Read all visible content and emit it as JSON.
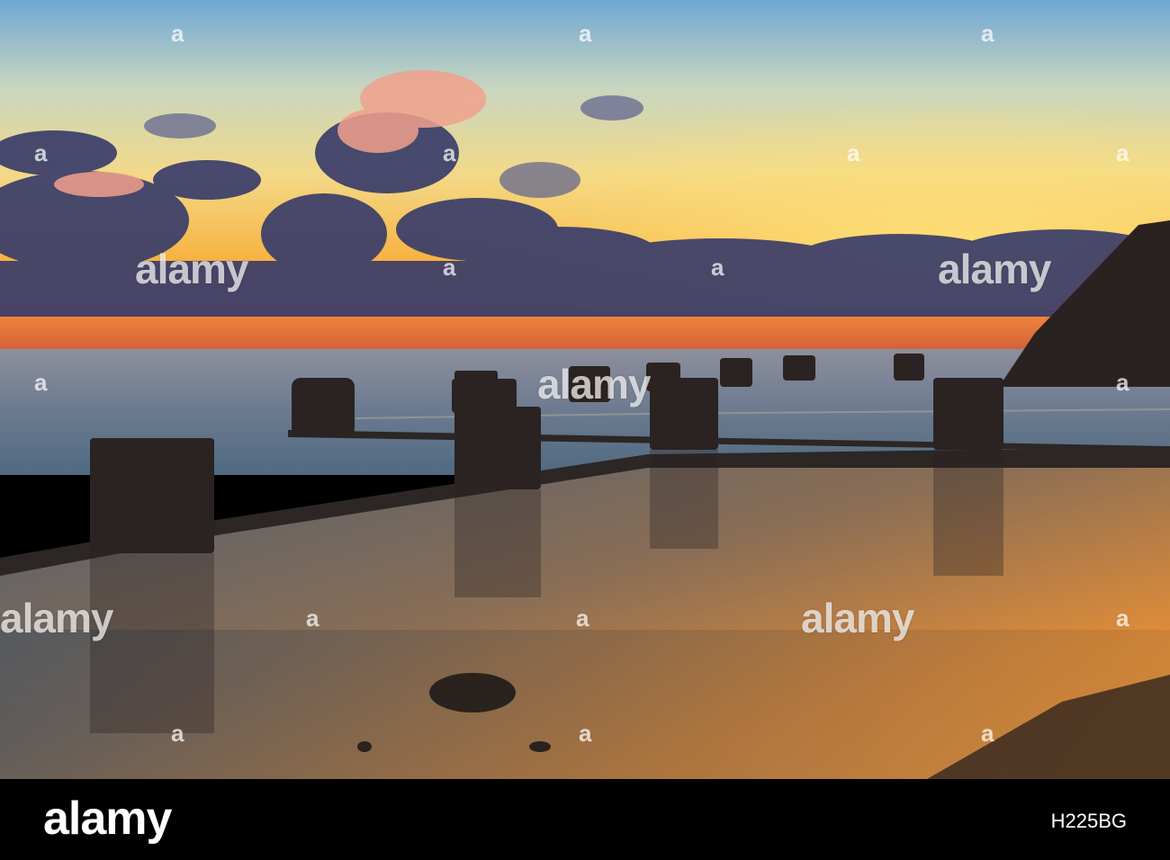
{
  "image": {
    "scene": "sunrise over an ocean rock pool with concrete pillars",
    "colors": {
      "sky_top": "#7fb0d6",
      "sky_glow": "#f6c24a",
      "horizon": "#f07a3a",
      "cloud": "#3b3d6b",
      "water": "#6f7f98",
      "pool_glow": "#d88a3a",
      "pillar": "#2a2422"
    }
  },
  "watermark": {
    "text": "alamy",
    "mark": "a"
  },
  "footer": {
    "logo": "alamy",
    "image_id": "H225BG"
  }
}
